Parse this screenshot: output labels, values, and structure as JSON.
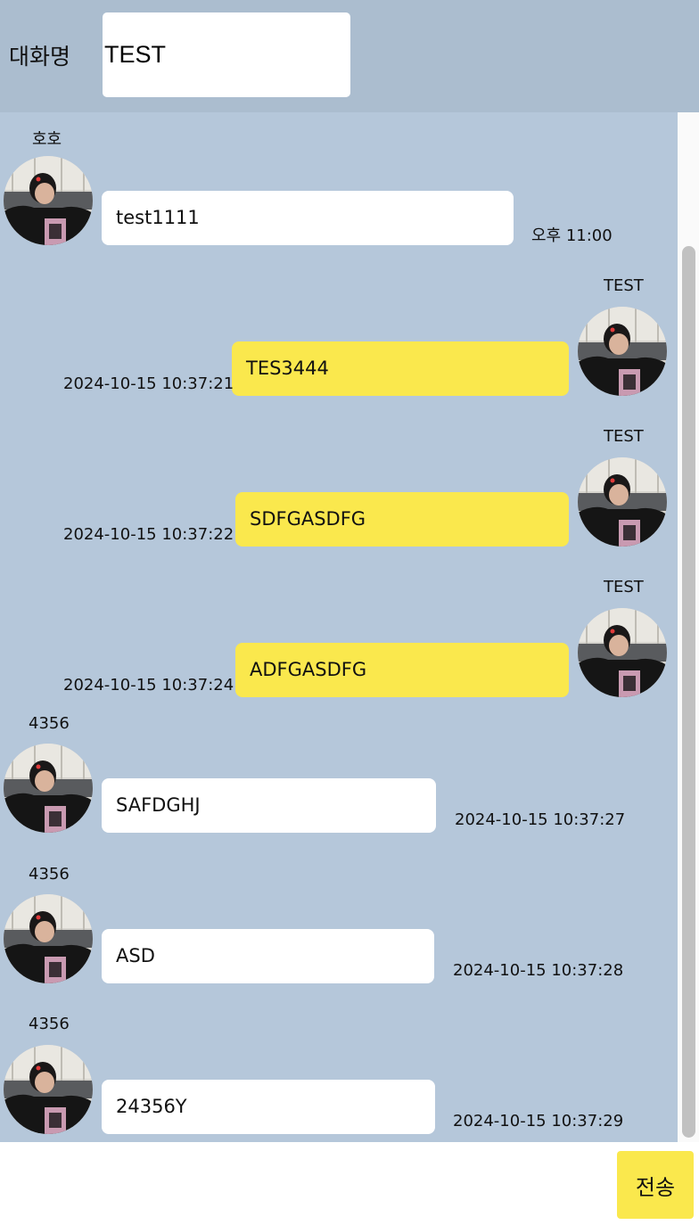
{
  "header": {
    "room_label": "대화명",
    "room_name_value": "TEST"
  },
  "messages": [
    {
      "sender": "호호",
      "text": "test1111",
      "time": "오후 11:00",
      "direction": "incoming"
    },
    {
      "sender": "TEST",
      "text": "TES3444",
      "time": "2024-10-15 10:37:21",
      "direction": "outgoing"
    },
    {
      "sender": "TEST",
      "text": "SDFGASDFG",
      "time": "2024-10-15 10:37:22",
      "direction": "outgoing"
    },
    {
      "sender": "TEST",
      "text": "ADFGASDFG",
      "time": "2024-10-15 10:37:24",
      "direction": "outgoing"
    },
    {
      "sender": "4356",
      "text": "SAFDGHJ",
      "time": "2024-10-15 10:37:27",
      "direction": "incoming"
    },
    {
      "sender": "4356",
      "text": "ASD",
      "time": "2024-10-15 10:37:28",
      "direction": "incoming"
    },
    {
      "sender": "4356",
      "text": "24356Y",
      "time": "2024-10-15 10:37:29",
      "direction": "incoming"
    }
  ],
  "footer": {
    "input_value": "",
    "send_label": "전송"
  },
  "colors": {
    "header_bg": "#abbdcf",
    "chat_bg": "#b5c7da",
    "incoming_bubble": "#ffffff",
    "outgoing_bubble": "#fae84d",
    "send_button": "#fae84d"
  }
}
